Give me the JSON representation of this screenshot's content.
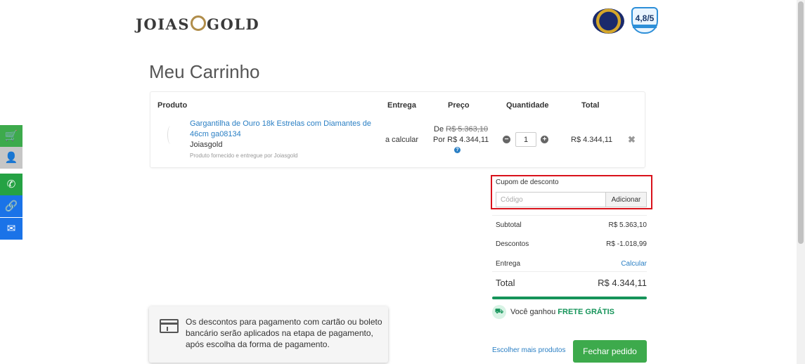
{
  "header": {
    "logo_left": "JOIAS",
    "logo_right": "GOLD",
    "rating": "4,8/5"
  },
  "page_title": "Meu Carrinho",
  "table": {
    "headers": {
      "product": "Produto",
      "delivery": "Entrega",
      "price": "Preço",
      "quantity": "Quantidade",
      "total": "Total"
    },
    "item": {
      "name": "Gargantilha de Ouro 18k Estrelas com Diamantes de 46cm ga08134",
      "brand": "Joiasgold",
      "note": "Produto fornecido e entregue por Joiasgold",
      "delivery": "a calcular",
      "price_old_prefix": "De",
      "price_old": "R$ 5.363,10",
      "price_new": "Por R$ 4.344,11",
      "quantity": "1",
      "line_total": "R$ 4.344,11"
    }
  },
  "coupon": {
    "label": "Cupom de desconto",
    "placeholder": "Código",
    "button": "Adicionar"
  },
  "summary": {
    "subtotal_label": "Subtotal",
    "subtotal_value": "R$ 5.363,10",
    "discount_label": "Descontos",
    "discount_value": "R$ -1.018,99",
    "delivery_label": "Entrega",
    "delivery_action": "Calcular",
    "total_label": "Total",
    "total_value": "R$ 4.344,11",
    "free_shipping_prefix": "Você ganhou",
    "free_shipping_bold": "FRETE GRÁTIS",
    "more_products": "Escolher mais produtos",
    "checkout": "Fechar pedido"
  },
  "info_box": {
    "message": "Os descontos para pagamento com cartão ou boleto bancário serão aplicados na etapa de pagamento, após escolha da forma de pagamento."
  },
  "colors": {
    "accent_green": "#3daa4c",
    "link_blue": "#2a7fc4",
    "highlight_red": "#d9121b"
  }
}
